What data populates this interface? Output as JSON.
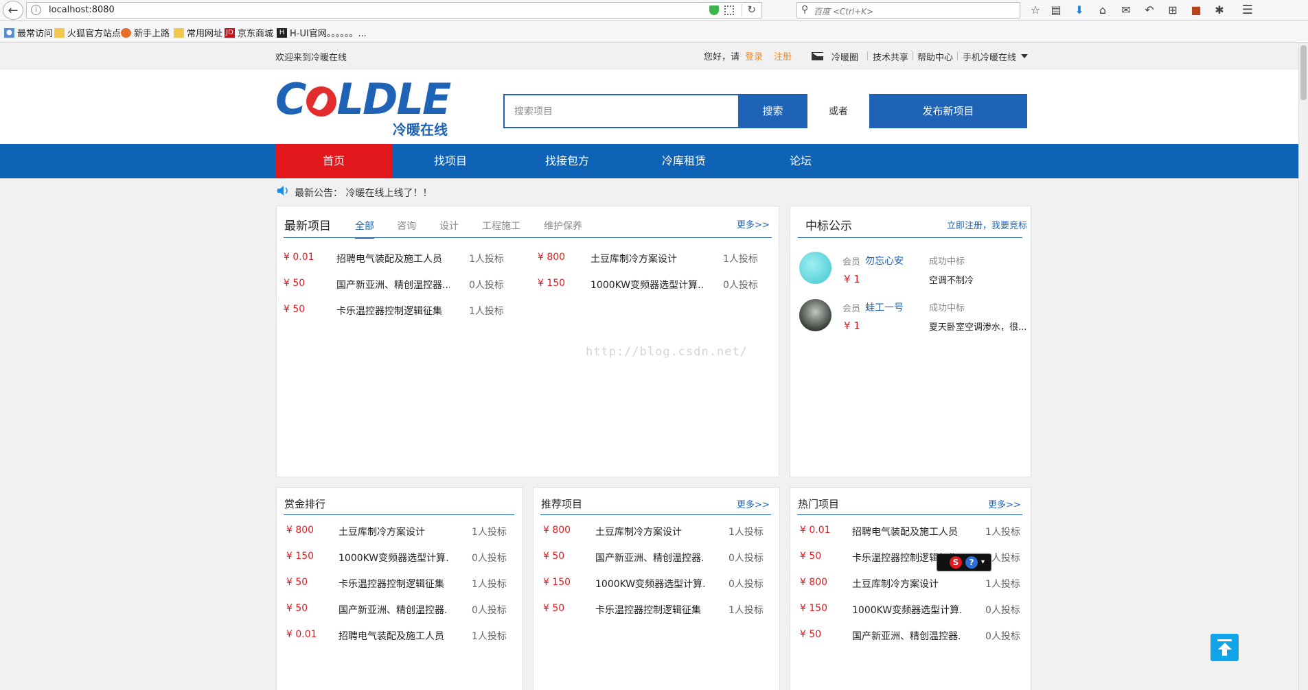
{
  "browser": {
    "url": "localhost:8080",
    "search_placeholder": "百度 <Ctrl+K>"
  },
  "bookmarks": [
    {
      "label": "最常访问"
    },
    {
      "label": "火狐官方站点"
    },
    {
      "label": "新手上路"
    },
    {
      "label": "常用网址"
    },
    {
      "label": "京东商城"
    },
    {
      "label": "H-UI官网。。。。。。..."
    }
  ],
  "topbar": {
    "welcome": "欢迎来到冷暖在线",
    "hello": "您好，请",
    "login": "登录",
    "register": "注册",
    "links": [
      "冷暖圈",
      "技术共享",
      "帮助中心",
      "手机冷暖在线"
    ]
  },
  "header": {
    "logo_main": "C",
    "logo_rest": "LDLE",
    "logo_sub": "冷暖在线",
    "search_placeholder": "搜索项目",
    "search_button": "搜索",
    "or_text": "或者",
    "publish_button": "发布新项目"
  },
  "nav": [
    "首页",
    "找项目",
    "找接包方",
    "冷库租赁",
    "论坛"
  ],
  "notice": "最新公告： 冷暖在线上线了！！",
  "latest": {
    "title": "最新项目",
    "tabs": [
      "全部",
      "咨询",
      "设计",
      "工程施工",
      "维护保养"
    ],
    "more": "更多>>",
    "items": [
      {
        "price": "¥ 0.01",
        "name": "招聘电气装配及施工人员",
        "bids": "1人投标"
      },
      {
        "price": "¥ 800",
        "name": "土豆库制冷方案设计",
        "bids": "1人投标"
      },
      {
        "price": "¥ 50",
        "name": "国产新亚洲、精创温控器...",
        "bids": "0人投标"
      },
      {
        "price": "¥ 150",
        "name": "1000KW变频器选型计算...",
        "bids": "0人投标"
      },
      {
        "price": "¥ 50",
        "name": "卡乐温控器控制逻辑征集",
        "bids": "1人投标"
      }
    ]
  },
  "winners": {
    "title": "中标公示",
    "link": "立即注册，我要竞标",
    "items": [
      {
        "member_label": "会员",
        "name": "勿忘心安",
        "status": "成功中标",
        "price": "¥ 1",
        "project": "空调不制冷"
      },
      {
        "member_label": "会员",
        "name": "蛙工一号",
        "status": "成功中标",
        "price": "¥ 1",
        "project": "夏天卧室空调渗水，很..."
      }
    ]
  },
  "watermark": "http://blog.csdn.net/",
  "reward": {
    "title": "赏金排行",
    "items": [
      {
        "price": "¥ 800",
        "name": "土豆库制冷方案设计",
        "bids": "1人投标"
      },
      {
        "price": "¥ 150",
        "name": "1000KW变频器选型计算...",
        "bids": "0人投标"
      },
      {
        "price": "¥ 50",
        "name": "卡乐温控器控制逻辑征集",
        "bids": "1人投标"
      },
      {
        "price": "¥ 50",
        "name": "国产新亚洲、精创温控器...",
        "bids": "0人投标"
      },
      {
        "price": "¥ 0.01",
        "name": "招聘电气装配及施工人员",
        "bids": "1人投标"
      }
    ]
  },
  "recommend": {
    "title": "推荐项目",
    "more": "更多>>",
    "items": [
      {
        "price": "¥ 800",
        "name": "土豆库制冷方案设计",
        "bids": "1人投标"
      },
      {
        "price": "¥ 50",
        "name": "国产新亚洲、精创温控器...",
        "bids": "0人投标"
      },
      {
        "price": "¥ 150",
        "name": "1000KW变频器选型计算...",
        "bids": "0人投标"
      },
      {
        "price": "¥ 50",
        "name": "卡乐温控器控制逻辑征集",
        "bids": "1人投标"
      }
    ]
  },
  "hot": {
    "title": "热门项目",
    "more": "更多>>",
    "items": [
      {
        "price": "¥ 0.01",
        "name": "招聘电气装配及施工人员",
        "bids": "1人投标"
      },
      {
        "price": "¥ 50",
        "name": "卡乐温控器控制逻辑征集",
        "bids": "1人投标"
      },
      {
        "price": "¥ 800",
        "name": "土豆库制冷方案设计",
        "bids": "1人投标"
      },
      {
        "price": "¥ 150",
        "name": "1000KW变频器选型计算...",
        "bids": "0人投标"
      },
      {
        "price": "¥ 50",
        "name": "国产新亚洲、精创温控器...",
        "bids": "0人投标"
      }
    ]
  },
  "colors": {
    "brand_blue": "#1e63b5",
    "nav_active": "#e3181c",
    "price_red": "#e3181c",
    "accent_orange": "#f08a24"
  }
}
